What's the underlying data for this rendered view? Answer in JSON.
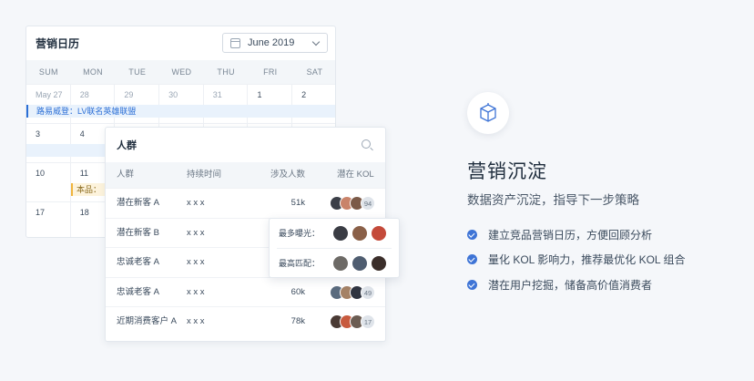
{
  "calendar": {
    "title": "营销日历",
    "month": "June 2019",
    "weekdays": [
      "SUM",
      "MON",
      "TUE",
      "WED",
      "THU",
      "FRI",
      "SAT"
    ],
    "weeks": [
      [
        "May 27",
        "28",
        "29",
        "30",
        "31",
        "1",
        "2"
      ],
      [
        "3",
        "4",
        "",
        "",
        "",
        "",
        ""
      ],
      [
        "10",
        "11",
        "",
        "",
        "",
        "",
        ""
      ],
      [
        "17",
        "18",
        "",
        "",
        "",
        "",
        ""
      ]
    ],
    "event_week1": "路易威登：LV联名英雄联盟",
    "event_week3": "本品："
  },
  "people": {
    "title": "人群",
    "columns": [
      "人群",
      "持续时间",
      "涉及人数",
      "潜在 KOL"
    ],
    "rows": [
      {
        "name": "潜在新客 A",
        "duration": "x x x",
        "count": "51k",
        "kol_more": "94"
      },
      {
        "name": "潜在新客 B",
        "duration": "x x x",
        "count": "",
        "kol_more": ""
      },
      {
        "name": "忠诚老客 A",
        "duration": "x x x",
        "count": "",
        "kol_more": ""
      },
      {
        "name": "忠诚老客 A",
        "duration": "x x x",
        "count": "60k",
        "kol_more": "49"
      },
      {
        "name": "近期消费客户 A",
        "duration": "x x x",
        "count": "78k",
        "kol_more": "17"
      }
    ]
  },
  "popover": {
    "most_exposure": "最多曝光：",
    "best_match": "最高匹配："
  },
  "feature": {
    "icon": "cube-icon",
    "title": "营销沉淀",
    "subtitle": "数据资产沉淀，指导下一步策略",
    "points": [
      "建立竞品营销日历，方便回顾分析",
      "量化 KOL 影响力，推荐最优化 KOL 组合",
      "潜在用户挖掘，储备高价值消费者"
    ]
  },
  "colors": {
    "accent": "#3e74d6",
    "event_blue": "#2b6fd6",
    "event_yellow": "#f0b43c"
  }
}
